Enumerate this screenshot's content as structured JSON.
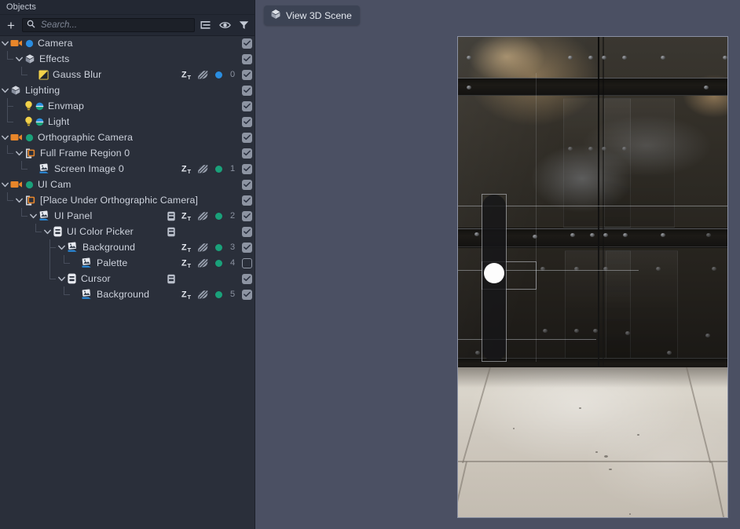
{
  "panel": {
    "title": "Objects",
    "toolbar": {
      "add_label": "+",
      "add_name": "plus-icon",
      "search_placeholder": "Search...",
      "search_value": "",
      "buttons": [
        {
          "name": "outline-list-icon",
          "label": "Outline"
        },
        {
          "name": "eye-icon",
          "label": "Visibility"
        },
        {
          "name": "filter-icon",
          "label": "Filter"
        }
      ]
    }
  },
  "colors": {
    "panel_bg": "#2a2f3a",
    "toolbar_bg": "#232833",
    "viewport_bg": "#4b5063",
    "tab_bg": "#3c4354",
    "accent_orange": "#e8862a",
    "accent_blue": "#2a8de0",
    "accent_green": "#1aa17a",
    "accent_yellow": "#f2d24a",
    "check_fill": "#8d94a2",
    "text": "#cdd2dc",
    "muted_text": "#8b92a0"
  },
  "tree": [
    {
      "label": "Camera",
      "depth": 0,
      "twisty": "down",
      "icons": [
        "camera-orange-icon",
        "blue-dot-icon"
      ],
      "right": {
        "layout": false,
        "ztest": false,
        "shadow": false,
        "dot": null,
        "num": null,
        "checked": true
      }
    },
    {
      "label": "Effects",
      "depth": 1,
      "twisty": "down",
      "icons": [
        "cube-gray-icon"
      ],
      "right": {
        "layout": false,
        "ztest": false,
        "shadow": false,
        "dot": null,
        "num": null,
        "checked": true
      }
    },
    {
      "label": "Gauss Blur",
      "depth": 2,
      "twisty": "none",
      "icons": [
        "gauss-blur-yellow-icon"
      ],
      "right": {
        "layout": false,
        "ztest": true,
        "shadow": true,
        "dot": "#2a8de0",
        "num": "0",
        "checked": true
      }
    },
    {
      "label": "Lighting",
      "depth": 0,
      "twisty": "down",
      "icons": [
        "cube-gray-icon"
      ],
      "right": {
        "layout": false,
        "ztest": false,
        "shadow": false,
        "dot": null,
        "num": null,
        "checked": true
      }
    },
    {
      "label": "Envmap",
      "depth": 1,
      "twisty": "none",
      "icons": [
        "light-bulb-icon",
        "half-circle-icon"
      ],
      "right": {
        "layout": false,
        "ztest": false,
        "shadow": false,
        "dot": null,
        "num": null,
        "checked": true
      }
    },
    {
      "label": "Light",
      "depth": 1,
      "twisty": "none",
      "icons": [
        "light-bulb-icon",
        "half-circle-icon"
      ],
      "right": {
        "layout": false,
        "ztest": false,
        "shadow": false,
        "dot": null,
        "num": null,
        "checked": true
      }
    },
    {
      "label": "Orthographic Camera",
      "depth": 0,
      "twisty": "down",
      "icons": [
        "camera-orange-icon",
        "green-dot-icon"
      ],
      "right": {
        "layout": false,
        "ztest": false,
        "shadow": false,
        "dot": null,
        "num": null,
        "checked": true
      }
    },
    {
      "label": "Full Frame Region 0",
      "depth": 1,
      "twisty": "down",
      "icons": [
        "frame-region-icon"
      ],
      "right": {
        "layout": false,
        "ztest": false,
        "shadow": false,
        "dot": null,
        "num": null,
        "checked": true
      }
    },
    {
      "label": "Screen Image 0",
      "depth": 2,
      "twisty": "none",
      "icons": [
        "screen-image-icon"
      ],
      "right": {
        "layout": false,
        "ztest": true,
        "shadow": true,
        "dot": "#1aa17a",
        "num": "1",
        "checked": true
      }
    },
    {
      "label": "UI Cam",
      "depth": 0,
      "twisty": "down",
      "icons": [
        "camera-orange-icon",
        "green-dot-icon"
      ],
      "right": {
        "layout": false,
        "ztest": false,
        "shadow": false,
        "dot": null,
        "num": null,
        "checked": true
      }
    },
    {
      "label": "[Place Under Orthographic Camera]",
      "depth": 1,
      "twisty": "down",
      "icons": [
        "frame-region-icon"
      ],
      "right": {
        "layout": false,
        "ztest": false,
        "shadow": false,
        "dot": null,
        "num": null,
        "checked": true
      }
    },
    {
      "label": "UI Panel",
      "depth": 2,
      "twisty": "down",
      "icons": [
        "screen-image-icon"
      ],
      "right": {
        "layout": true,
        "ztest": true,
        "shadow": true,
        "dot": "#1aa17a",
        "num": "2",
        "checked": true
      }
    },
    {
      "label": "UI Color Picker",
      "depth": 3,
      "twisty": "down",
      "icons": [
        "ui-widget-icon"
      ],
      "right": {
        "layout": true,
        "ztest": false,
        "shadow": false,
        "dot": null,
        "num": null,
        "checked": true
      }
    },
    {
      "label": "Background",
      "depth": 4,
      "twisty": "down",
      "icons": [
        "screen-image-icon"
      ],
      "right": {
        "layout": false,
        "ztest": true,
        "shadow": true,
        "dot": "#1aa17a",
        "num": "3",
        "checked": true
      }
    },
    {
      "label": "Palette",
      "depth": 5,
      "twisty": "none",
      "icons": [
        "screen-image-icon"
      ],
      "right": {
        "layout": false,
        "ztest": true,
        "shadow": true,
        "dot": "#1aa17a",
        "num": "4",
        "checked": false
      }
    },
    {
      "label": "Cursor",
      "depth": 4,
      "twisty": "down",
      "icons": [
        "ui-widget-icon"
      ],
      "right": {
        "layout": true,
        "ztest": false,
        "shadow": false,
        "dot": null,
        "num": null,
        "checked": true
      }
    },
    {
      "label": "Background",
      "depth": 5,
      "twisty": "none",
      "icons": [
        "screen-image-icon"
      ],
      "right": {
        "layout": false,
        "ztest": true,
        "shadow": true,
        "dot": "#1aa17a",
        "num": "5",
        "checked": true
      }
    }
  ],
  "viewport": {
    "tab": {
      "label": "View 3D Scene",
      "icon": "cube-icon",
      "active": true
    },
    "scene": {
      "description": "Rendered 3D scene: dark riveted metal double doors above a light concrete tile floor",
      "overlay": {
        "palette_bar": "vertical rounded dark palette bar",
        "cursor": "white circular color-picker cursor"
      }
    }
  }
}
